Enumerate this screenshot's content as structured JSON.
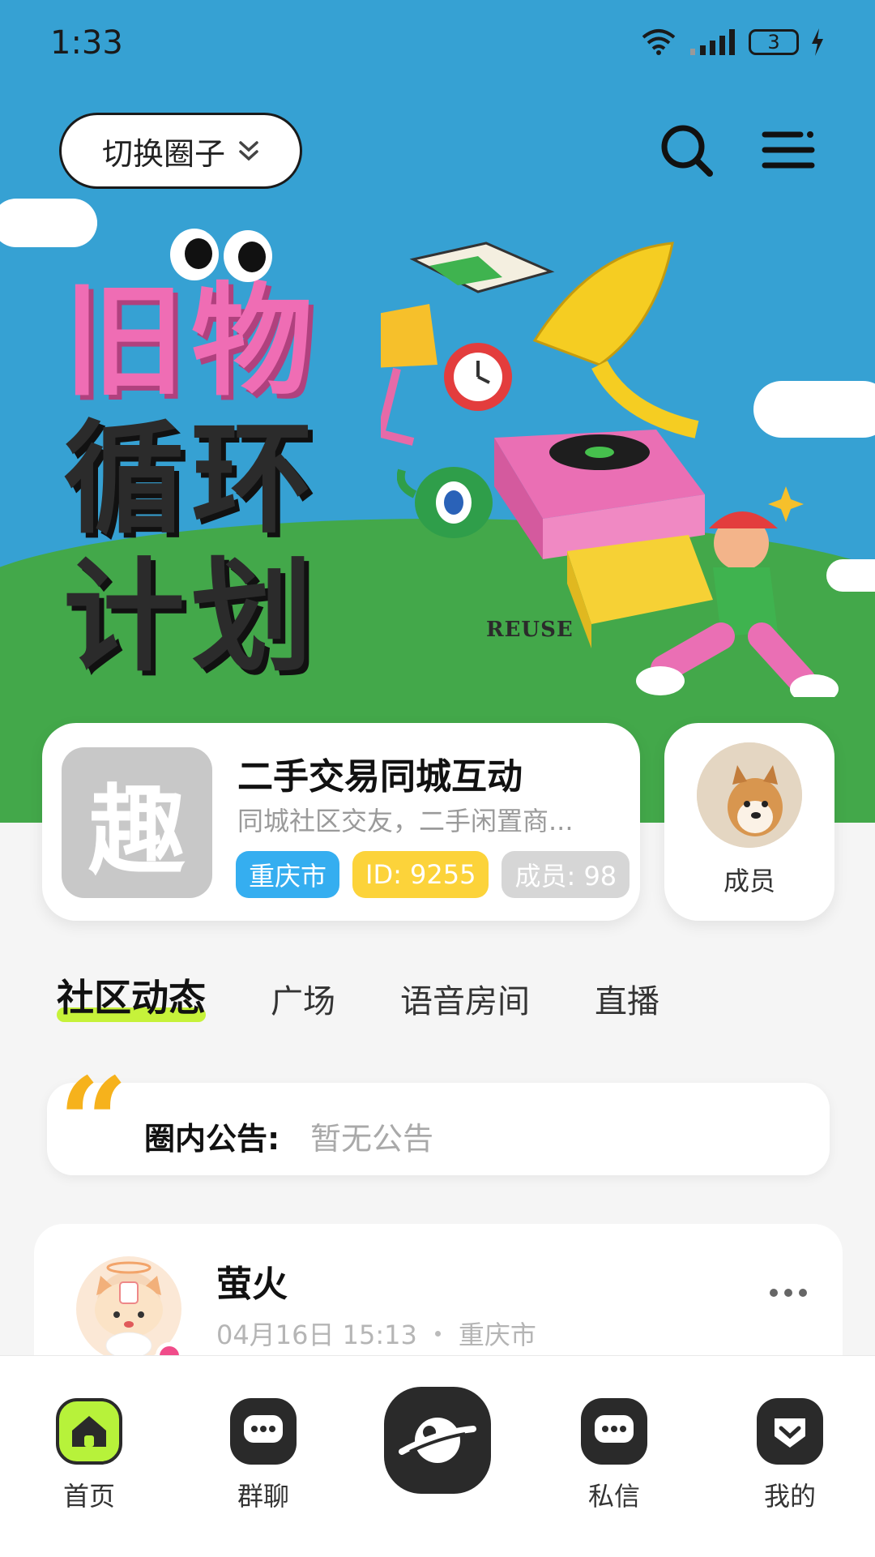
{
  "status_bar": {
    "time": "1:33",
    "battery": "3"
  },
  "header": {
    "switch_label": "切换圈子"
  },
  "banner": {
    "line1": "旧物",
    "line2": "循环",
    "line3": "计划",
    "tag": "REUSE"
  },
  "group": {
    "logo_char": "趣",
    "name": "二手交易同城互动",
    "description": "同城社区交友，二手闲置商...",
    "tags": [
      "重庆市",
      "ID: 9255",
      "成员: 98"
    ],
    "members_label": "成员"
  },
  "tabs": [
    "社区动态",
    "广场",
    "语音房间",
    "直播"
  ],
  "notice": {
    "label": "圈内公告:",
    "value": "暂无公告"
  },
  "post": {
    "user": "萤火",
    "time": "04月16日 15:13",
    "location": "重庆市"
  },
  "bottom_nav": [
    "首页",
    "群聊",
    "私信",
    "我的"
  ],
  "colors": {
    "accent": "#b7f23a",
    "tag_blue": "#35aef0",
    "tag_yellow": "#fcd33a",
    "quote": "#f6b21c"
  }
}
